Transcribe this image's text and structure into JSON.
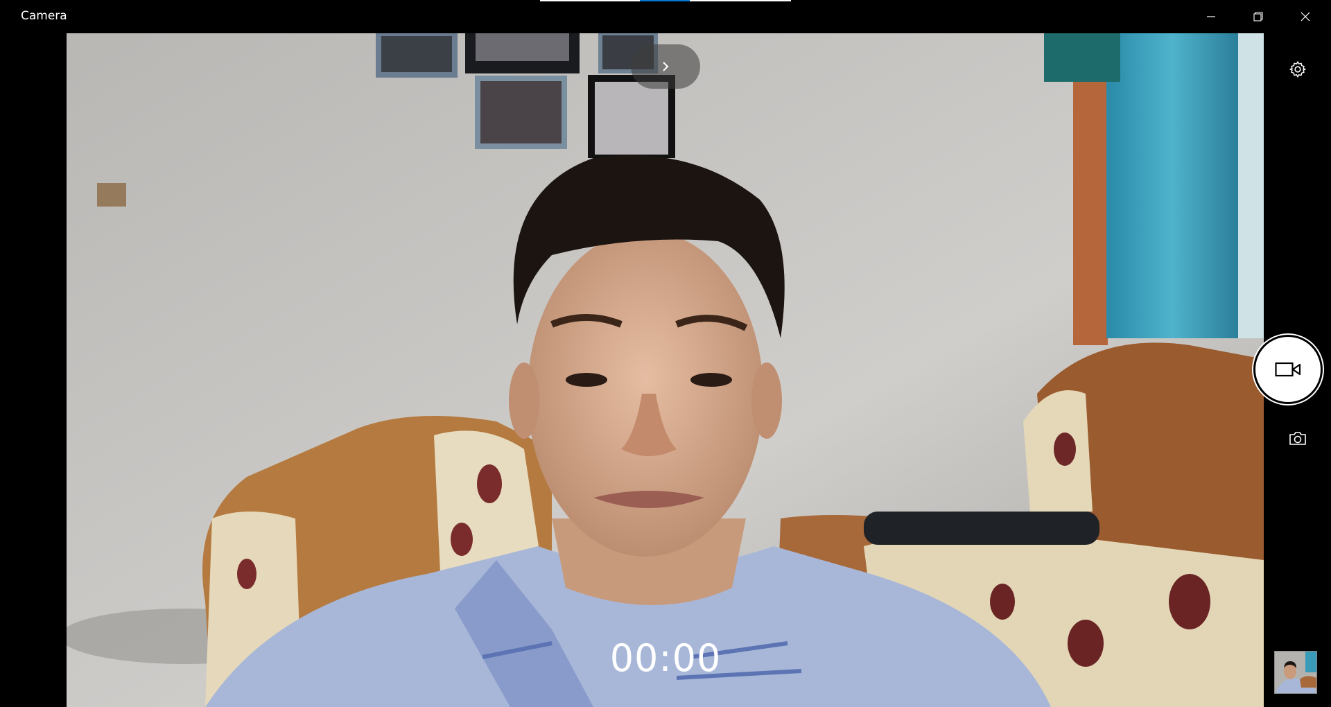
{
  "window": {
    "title": "Camera"
  },
  "caption": {
    "minimize_icon": "minimize-icon",
    "maximize_icon": "restore-icon",
    "close_icon": "close-icon"
  },
  "mode_indicator": {
    "base_color": "#ffffff",
    "active_color": "#0078d7"
  },
  "controls": {
    "settings_icon": "gear-icon",
    "video_icon": "video-camera-icon",
    "photo_icon": "camera-icon",
    "expand_icon": "chevron-right-icon"
  },
  "recording": {
    "timer": "00:00"
  }
}
